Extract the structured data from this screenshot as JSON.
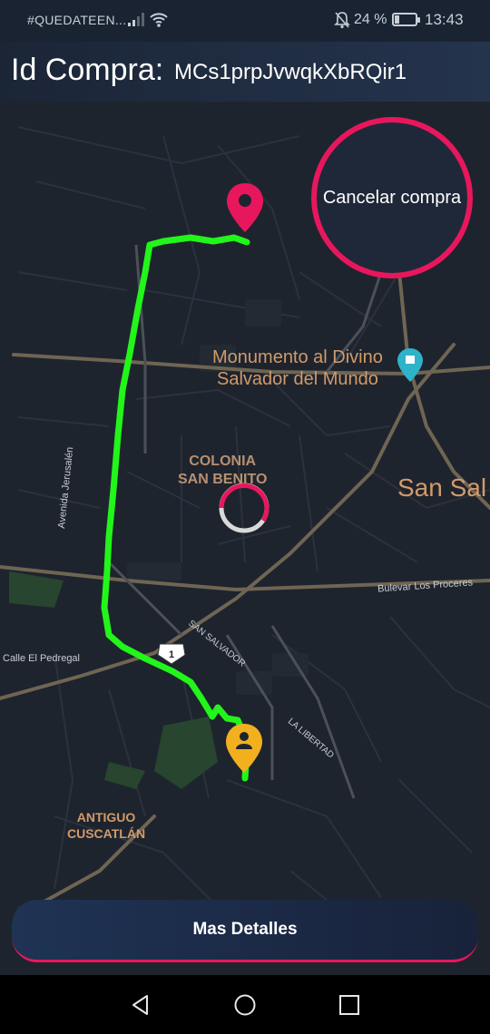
{
  "status_bar": {
    "carrier": "#QUEDATEEN...",
    "battery_pct": "24 %",
    "battery_level": 0.24,
    "time": "13:43"
  },
  "header": {
    "label": "Id Compra:",
    "purchase_id": "MCs1prpJvwqkXbRQir1"
  },
  "map": {
    "labels": {
      "monumento_line1": "Monumento al Divino",
      "monumento_line2": "Salvador del Mundo",
      "colonia_line1": "COLONIA",
      "colonia_line2": "SAN BENITO",
      "san_sal": "San Sal",
      "antiguo_line1": "ANTIGUO",
      "antiguo_line2": "CUSCATLÁN",
      "avenida": "Avenida Jerusalén",
      "bulevar": "Bulevar Los Proceres",
      "pedregal": "Calle El Pedregal",
      "san_salvador": "SAN SALVADOR",
      "la_libertad": "LA LIBERTAD",
      "route_shield": "1"
    },
    "colors": {
      "route": "#22f51a",
      "destination": "#e8175d",
      "origin": "#f2b01e",
      "landmark": "#2fb3c8"
    }
  },
  "buttons": {
    "cancel": "Cancelar compra",
    "details": "Mas Detalles"
  },
  "icons": [
    "signal-icon",
    "wifi-icon",
    "bell-off-icon",
    "battery-icon",
    "destination-pin-icon",
    "origin-person-pin-icon",
    "landmark-pin-icon",
    "loading-spinner-icon",
    "back-icon",
    "home-icon",
    "recents-icon"
  ]
}
